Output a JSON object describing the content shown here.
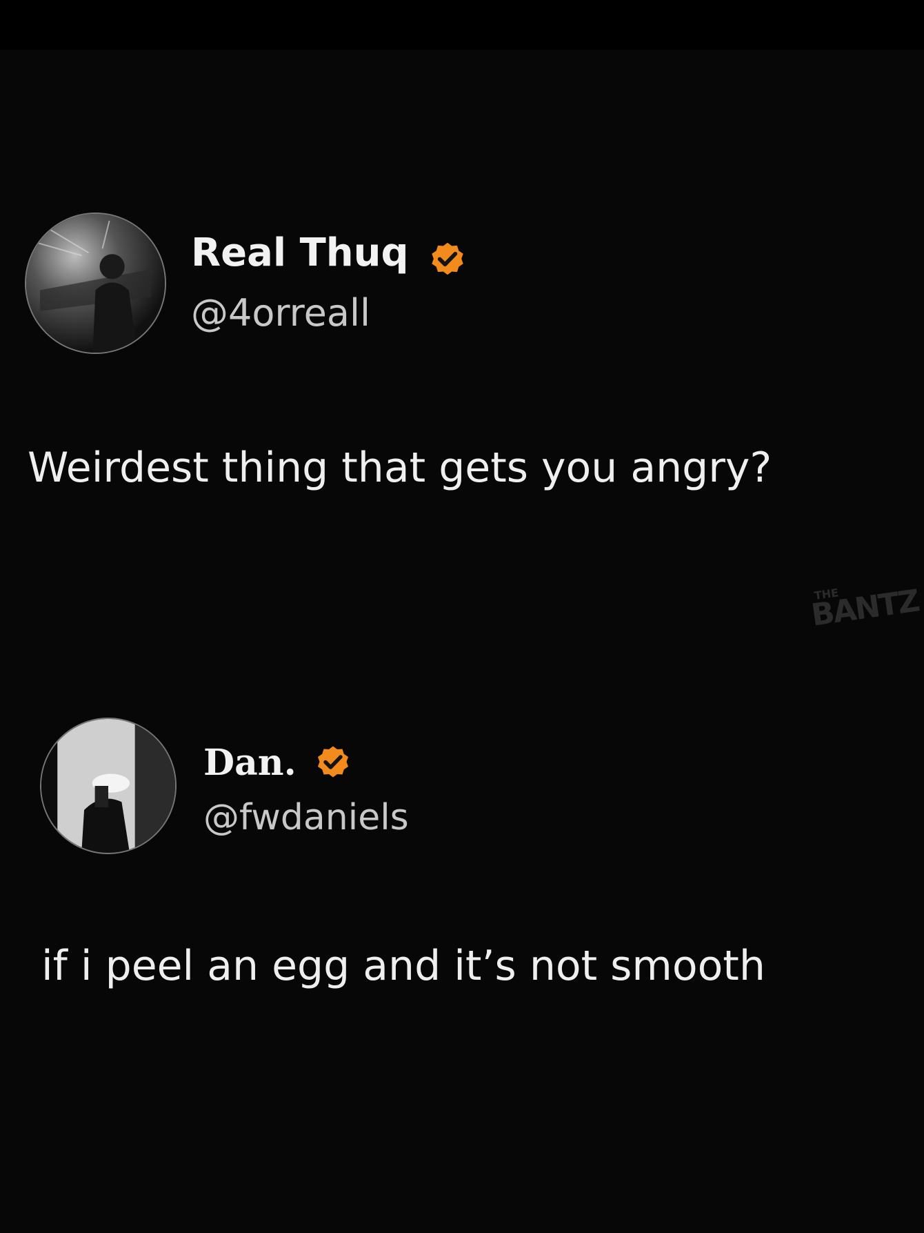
{
  "colors": {
    "background": "#070707",
    "verified_badge": "#F28B1C",
    "text_primary": "#EFEFEF",
    "text_secondary": "#C8C8C8"
  },
  "post": {
    "author": {
      "name": "Real Thuq",
      "handle": "@4orreall",
      "verified": true,
      "avatar_icon": "avatar-photo"
    },
    "text": "Weirdest thing that gets you angry?"
  },
  "reply": {
    "author": {
      "name": "Dan.",
      "handle": "@fwdaniels",
      "verified": true,
      "avatar_icon": "avatar-photo"
    },
    "text": "if i peel an egg and it’s not smooth"
  },
  "watermark": {
    "line1": "THE",
    "line2": "BANTZ"
  }
}
